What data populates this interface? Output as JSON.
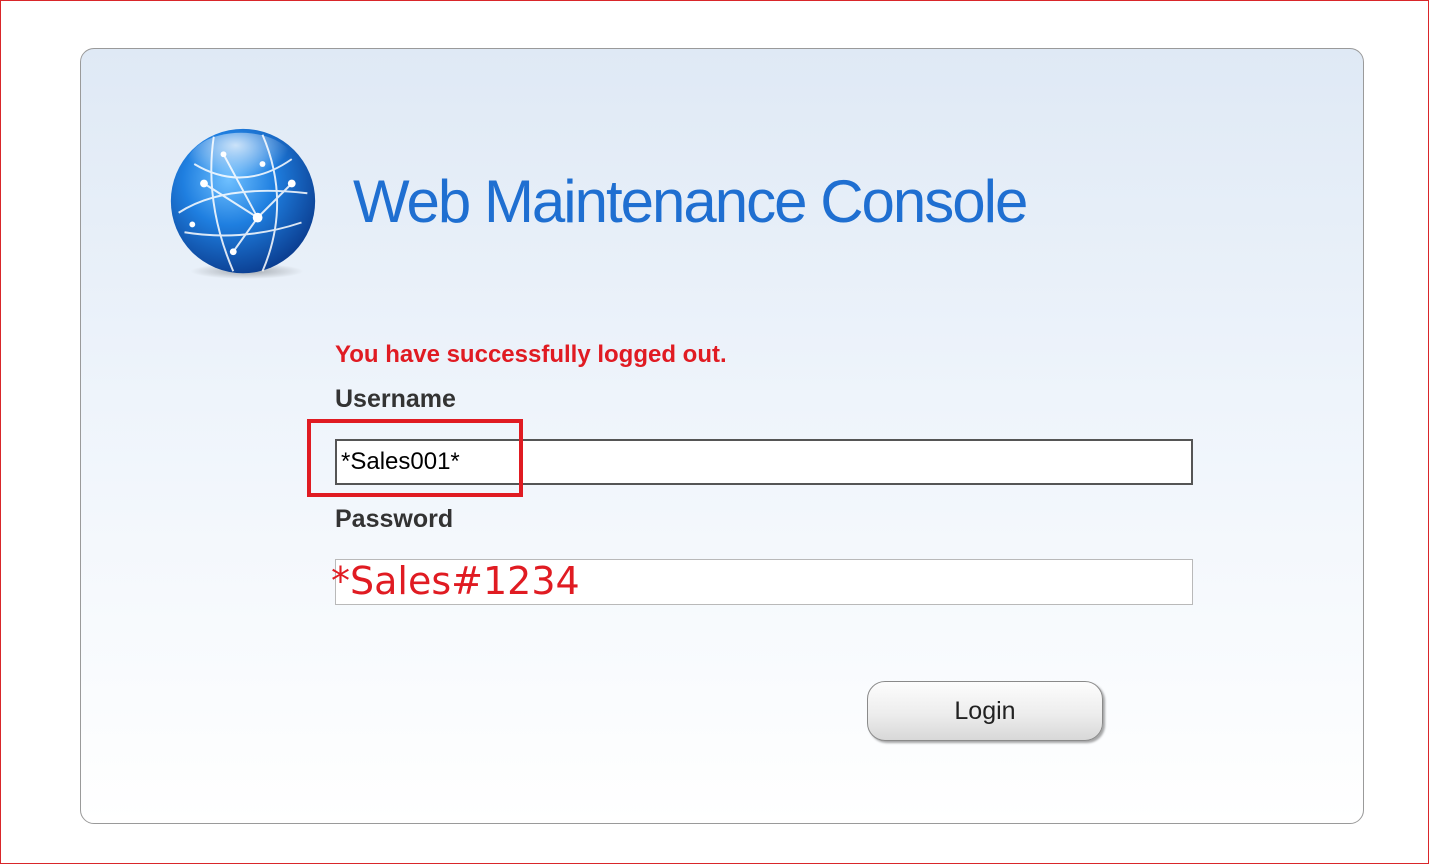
{
  "app": {
    "title": "Web Maintenance Console"
  },
  "logo": {
    "icon": "globe-network-icon"
  },
  "status": {
    "message": "You have successfully logged out."
  },
  "form": {
    "username_label": "Username",
    "username_value": "*Sales001*",
    "password_label": "Password",
    "password_value": ""
  },
  "annotation": {
    "password_hint": "*Sales#1234"
  },
  "buttons": {
    "login_label": "Login"
  },
  "colors": {
    "title": "#1f6fd1",
    "error": "#e01b22",
    "annotation": "#e01b22"
  }
}
